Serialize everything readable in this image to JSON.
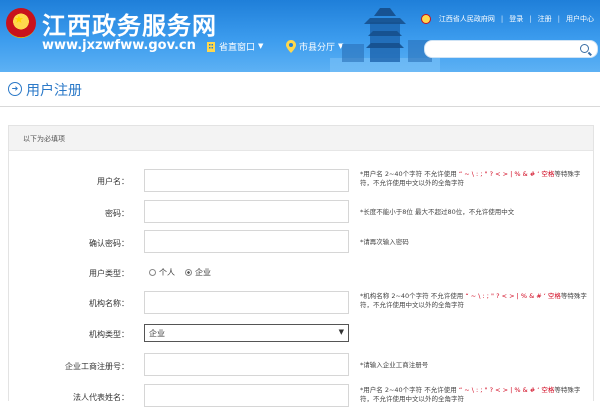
{
  "header": {
    "site_name": "江西政务服务网",
    "site_url": "www.jxzwfww.gov.cn",
    "nav": [
      {
        "label": "省直窗口",
        "icon": "building-icon"
      },
      {
        "label": "市县分厅",
        "icon": "location-pin-icon"
      }
    ],
    "top_links": {
      "gov_link": "江西省人民政府网",
      "login": "登录",
      "separator": "|",
      "register": "注册",
      "user_center": "用户中心"
    },
    "search_placeholder": ""
  },
  "page": {
    "title": "用户注册"
  },
  "form": {
    "section_label": "以下为必填项",
    "rows": [
      {
        "label": "用户名：",
        "hint_pre": "*用户名 2~40个字符 不允许使用 ",
        "hint_red": "“ ~ \\ : ; \" ? < > | % & # ‘ 空格",
        "hint_post": "等特殊字符，不允许使用中文以外的全角字符"
      },
      {
        "label": "密码：",
        "hint_pre": "*长度不能小于8位 最大不超过80位，不允许使用中文",
        "hint_red": "",
        "hint_post": ""
      },
      {
        "label": "确认密码：",
        "hint_pre": "*请再次输入密码",
        "hint_red": "",
        "hint_post": ""
      },
      {
        "label": "用户类型："
      },
      {
        "label": "机构名称：",
        "hint_pre": "*机构名称 2~40个字符 不允许使用 ",
        "hint_red": "“ ~ \\ : ; \" ? < > | % & # ‘ 空格",
        "hint_post": "等特殊字符，不允许使用中文以外的全角字符"
      },
      {
        "label": "机构类型："
      },
      {
        "label": "企业工商注册号：",
        "hint_pre": "*请输入企业工商注册号",
        "hint_red": "",
        "hint_post": ""
      },
      {
        "label": "法人代表姓名：",
        "hint_pre": "*用户名 2~40个字符 不允许使用 ",
        "hint_red": "“ ~ \\ : ; \" ? < > | % & # ‘ 空格",
        "hint_post": "等特殊字符，不允许使用中文以外的全角字符"
      }
    ],
    "user_type": {
      "options": [
        "个人",
        "企业"
      ],
      "selected": "企业"
    },
    "org_type": {
      "value": "企业",
      "arrow": "▼"
    }
  },
  "colors": {
    "header_blue": "#1f7fd9",
    "title_blue": "#2b79c8",
    "hint_red": "#d0021b"
  }
}
